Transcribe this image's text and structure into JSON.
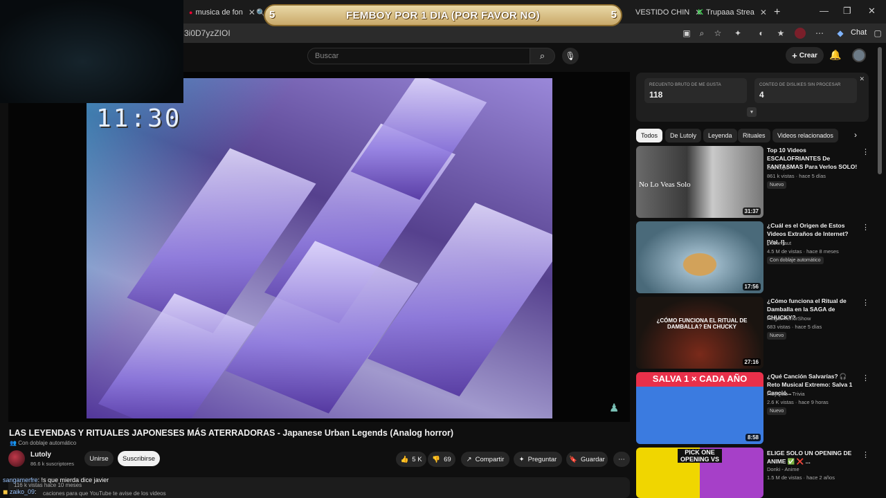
{
  "browser": {
    "tabs": [
      {
        "title": "musica de fon"
      },
      {
        "title": "VESTIDO CHIN"
      },
      {
        "title": "Trupaaa Strea"
      }
    ],
    "url": "3i0D7yzZIOI",
    "chat_label": "Chat"
  },
  "overlay": {
    "banner_title": "FEMBOY POR 1 DIA (POR FAVOR NO)",
    "banner_left_num": "5",
    "banner_right_num": "5"
  },
  "header": {
    "search_placeholder": "Buscar",
    "create_label": "Crear"
  },
  "video": {
    "timestamp_overlay": "11:30",
    "title": "LAS LEYENDAS Y RITUALES JAPONESES MÁS ATERRADORAS - Japanese Urban Legends (Analog horror)",
    "dub_badge": "Con doblaje automático",
    "channel_name": "Lutoly",
    "channel_subs": "86.6 k suscriptores",
    "join_label": "Unirse",
    "subscribe_label": "Suscribirse",
    "likes": "5 K",
    "dislikes": "69",
    "share_label": "Compartir",
    "ask_label": "Preguntar",
    "save_label": "Guardar",
    "views_line": "116 k vistas  hace 10 meses",
    "desc_line": "caciones para que YouTube te avise de los videos"
  },
  "chat": [
    {
      "user": "sangamerfre",
      "text": ": !s que mierda dice javier"
    },
    {
      "user": "zaiko_09",
      "text": ":"
    }
  ],
  "likes_panel": {
    "likes_label": "RECUENTO BRUTO DE ME GUSTA",
    "likes_value": "118",
    "dislikes_label": "CONTEO DE DISLIKES SIN PROCESAR",
    "dislikes_value": "4"
  },
  "chips": [
    "Todos",
    "De Lutoly",
    "Leyenda",
    "Rituales",
    "Videos relacionados"
  ],
  "recommendations": [
    {
      "title": "Top 10 Videos ESCALOFRIANTES De FANTASMAS Para Verlos SOLO!",
      "channel": "Doc Tops",
      "meta": "861 k vistas · hace 5 días",
      "badge": "Nuevo",
      "duration": "31:37",
      "thumb_text": "No Lo Veas Solo"
    },
    {
      "title": "¿Cuál es el Origen de Estos Videos Extraños de Internet? [Vol. I]",
      "channel": "clubernaut",
      "meta": "4.5 M de vistas · hace 8 meses",
      "badge": "Con doblaje automático",
      "duration": "17:56",
      "thumb_text": ""
    },
    {
      "title": "¿Cómo funciona el Ritual de Damballa en la SAGA de CHUCKY?",
      "channel": "PingüinTerrorShow",
      "meta": "683 vistas · hace 5 días",
      "badge": "Nuevo",
      "duration": "27:16",
      "thumb_text": "¿CÓMO FUNCIONA EL RITUAL DE DAMBALLA? EN CHUCKY"
    },
    {
      "title": "¿Qué Canción Salvarías? 🎧 Reto Musical Extremo: Salva 1 Canció...",
      "channel": "PlayQuiz - Trivia",
      "meta": "2.6 K vistas · hace 9 horas",
      "badge": "Nuevo",
      "duration": "8:58",
      "thumb_text": "SALVA 1 × CADA AÑO"
    },
    {
      "title": "ELIGE SOLO UN OPENING DE ANIME ✅ ❌ ...",
      "channel": "Donki - Anime",
      "meta": "1.5 M de vistas · hace 2 años",
      "badge": "",
      "duration": "",
      "thumb_text": "PICK ONE OPENING VS"
    }
  ],
  "colors": {
    "background": "#0f0f0f",
    "banner": "#d9bf85",
    "accent_like": "#f1f1f1"
  }
}
